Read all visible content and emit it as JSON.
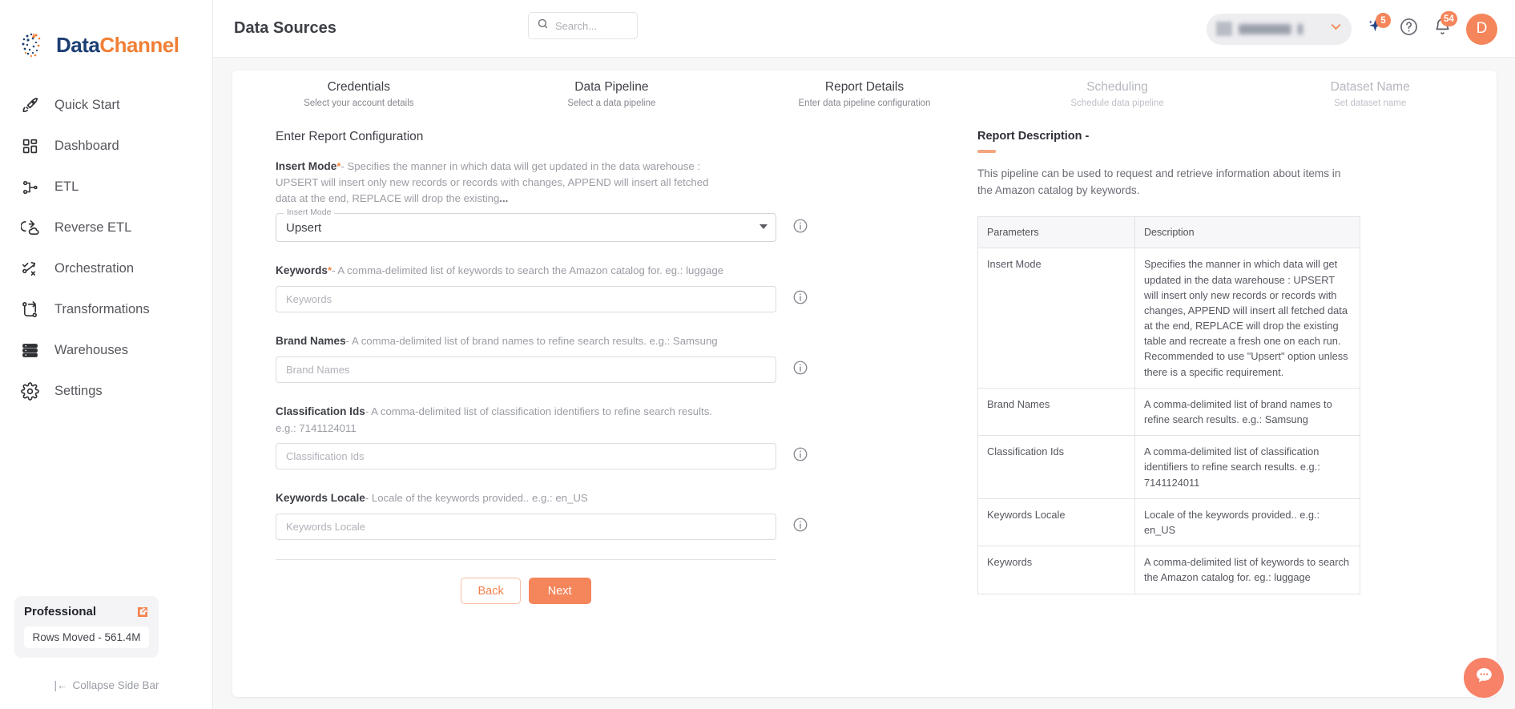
{
  "brand": {
    "name_part1": "Data",
    "name_part2": "Channel",
    "logo_icon": "datachannel-logo-icon"
  },
  "colors": {
    "accent": "#f5855a",
    "accent_light": "#f5a57f",
    "brand_blue": "#1d3f73",
    "brand_orange": "#f07f35",
    "chat_fab": "#f78268"
  },
  "sidebar": {
    "items": [
      {
        "label": "Quick Start",
        "icon": "rocket-icon"
      },
      {
        "label": "Dashboard",
        "icon": "grid-icon"
      },
      {
        "label": "ETL",
        "icon": "etl-flow-icon"
      },
      {
        "label": "Reverse ETL",
        "icon": "reverse-etl-icon"
      },
      {
        "label": "Orchestration",
        "icon": "orchestration-icon"
      },
      {
        "label": "Transformations",
        "icon": "transformations-icon"
      },
      {
        "label": "Warehouses",
        "icon": "warehouse-stack-icon"
      },
      {
        "label": "Settings",
        "icon": "gear-icon"
      }
    ],
    "plan": {
      "name": "Professional",
      "external_link_icon": "external-link-icon",
      "rows_moved": "Rows Moved - 561.4M"
    },
    "collapse_label": "Collapse Side Bar",
    "collapse_icon": "collapse-left-icon"
  },
  "topbar": {
    "title": "Data Sources",
    "search": {
      "placeholder": "Search...",
      "value": "",
      "icon": "search-icon"
    },
    "workspace": {
      "label": "",
      "caret_icon": "chevron-down-icon",
      "logo_icon": "workspace-logo-icon"
    },
    "sparkle": {
      "icon": "sparkle-icon",
      "badge": "5"
    },
    "help": {
      "icon": "help-circle-icon"
    },
    "notifications": {
      "icon": "bell-icon",
      "badge": "54"
    },
    "avatar": {
      "initial": "D"
    }
  },
  "stepper": {
    "steps": [
      {
        "title": "Credentials",
        "subtitle": "Select your account details",
        "state": "active"
      },
      {
        "title": "Data Pipeline",
        "subtitle": "Select a data pipeline",
        "state": "active"
      },
      {
        "title": "Report Details",
        "subtitle": "Enter data pipeline configuration",
        "state": "active"
      },
      {
        "title": "Scheduling",
        "subtitle": "Schedule data pipeline",
        "state": "inactive"
      },
      {
        "title": "Dataset Name",
        "subtitle": "Set dataset name",
        "state": "inactive"
      }
    ]
  },
  "form": {
    "section_title": "Enter Report Configuration",
    "insert_mode": {
      "label": "Insert Mode",
      "required": "*",
      "hint": "- Specifies the manner in which data will get updated in the data warehouse : UPSERT will insert only new records or records with changes, APPEND will insert all fetched data at the end, REPLACE will drop the existing",
      "hint_ellipsis": "...",
      "notch_label": "Insert Mode",
      "value": "Upsert",
      "info_icon": "info-circle-icon"
    },
    "fields": [
      {
        "label": "Keywords",
        "required": "*",
        "hint": "- A comma-delimited list of keywords to search the Amazon catalog for. eg.: luggage",
        "placeholder": "Keywords",
        "value": "",
        "info_icon": "info-circle-icon"
      },
      {
        "label": "Brand Names",
        "required": "",
        "hint": "- A comma-delimited list of brand names to refine search results. e.g.: Samsung",
        "placeholder": "Brand Names",
        "value": "",
        "info_icon": "info-circle-icon"
      },
      {
        "label": "Classification Ids",
        "required": "",
        "hint": "- A comma-delimited list of classification identifiers to refine search results. e.g.: 7141124011",
        "placeholder": "Classification Ids",
        "value": "",
        "info_icon": "info-circle-icon"
      },
      {
        "label": "Keywords Locale",
        "required": "",
        "hint": "- Locale of the keywords provided.. e.g.: en_US",
        "placeholder": "Keywords Locale",
        "value": "",
        "info_icon": "info-circle-icon"
      }
    ],
    "back_label": "Back",
    "next_label": "Next"
  },
  "report_description": {
    "title": "Report Description -",
    "text": "This pipeline can be used to request and retrieve information about items in the Amazon catalog by keywords.",
    "table": {
      "headers": [
        "Parameters",
        "Description"
      ],
      "rows": [
        [
          "Insert Mode",
          "Specifies the manner in which data will get updated in the data warehouse : UPSERT will insert only new records or records with changes, APPEND will insert all fetched data at the end, REPLACE will drop the existing table and recreate a fresh one on each run. Recommended to use \"Upsert\" option unless there is a specific requirement."
        ],
        [
          "Brand Names",
          "A comma-delimited list of brand names to refine search results. e.g.: Samsung"
        ],
        [
          "Classification Ids",
          "A comma-delimited list of classification identifiers to refine search results. e.g.: 7141124011"
        ],
        [
          "Keywords Locale",
          "Locale of the keywords provided.. e.g.: en_US"
        ],
        [
          "Keywords",
          "A comma-delimited list of keywords to search the Amazon catalog for. eg.: luggage"
        ]
      ]
    }
  },
  "chat": {
    "icon": "chat-bubble-icon"
  }
}
